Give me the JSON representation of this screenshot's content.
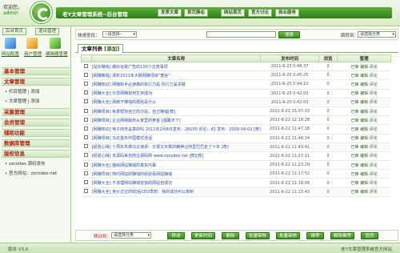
{
  "header": {
    "welcome": "欢迎您，",
    "user": "admin",
    "title": "老Y文章管理系统--后台管理",
    "links": [
      "发表文章",
      "首页静态",
      "网站首页",
      "官方讨论",
      "商业服务"
    ]
  },
  "sidebar": {
    "top_buttons": [
      "后台首页",
      "退出管理"
    ],
    "icon_links": [
      "网站配置",
      "用户管理",
      "编辑器管理"
    ],
    "sections": [
      {
        "title": "基本管理",
        "items": []
      },
      {
        "title": "文章管理",
        "items": [
          "栏目管理 | 添加",
          "文章管理 | 添加"
        ]
      },
      {
        "title": "采集管理",
        "items": []
      },
      {
        "title": "会员管理",
        "items": []
      },
      {
        "title": "辅助功能",
        "items": []
      },
      {
        "title": "数据库管理",
        "items": []
      },
      {
        "title": "版权信息",
        "items": [
          "zzcodes 源码发布",
          "官方网站：zzcodes.net"
        ]
      }
    ]
  },
  "filter": {
    "search_label": "快速查找：",
    "search_select": "--请选择--",
    "search_button": "搜索",
    "jump_label": "跳转到：",
    "jump_select": "请选择分类"
  },
  "list": {
    "tab_title": "文章列表",
    "tab_add": "[添加]",
    "columns": [
      "",
      "文章名称",
      "发布时间",
      "浏览",
      "管理"
    ],
    "rows": [
      {
        "title": "[站长赚钱] 做好谷歌广告的100个注意事项",
        "date": "2011-6-23 0:48:37",
        "views": "0",
        "ops": "已审 编辑 评论"
      },
      {
        "title": "[网赚教程] 诱析2011年大概网赚项目\"宽谷\"",
        "date": "2011-6-23 0:45:25",
        "views": "0",
        "ops": "已审 编辑 评论"
      },
      {
        "title": "[网赚知识] 网赚新手必读做的执行力是 执行力是关键",
        "date": "2011-6-23 0:44:10",
        "views": "0",
        "ops": "已审 编辑 评论"
      },
      {
        "title": "[网赚大全] 分享网赚如何生存成功",
        "date": "2011-6-23 0:42:03",
        "views": "0",
        "ops": "已审 编辑 评论"
      },
      {
        "title": "[网赚大全] 网络干赚钱的那些是什么",
        "date": "2011-6-23 0:42:03",
        "views": "0",
        "ops": "已审 编辑 评论"
      },
      {
        "title": "[网赚项目] 免费帮你自己的分站，自己赚钱[荐]",
        "date": "2011-6-22 15:07:33",
        "views": "0",
        "ops": "已审 编辑 评论"
      },
      {
        "title": "[网赚项目] 企业网络服务从家里的黄金 [福路天下]",
        "date": "2011-6-22 12:18:28",
        "views": "0",
        "ops": "已审 编辑 评论"
      },
      {
        "title": "[网赚知识] 电子商务是真的吗 2011年2月6日发布：28100 评论：43 发布：2009-04-03 [荐]",
        "date": "2011-6-22 11:47:18",
        "views": "0",
        "ops": "已审 编辑 评论"
      },
      {
        "title": "[网赚项目] 马云首年中国模式佳话",
        "date": "2011-6-22 11:46:24",
        "views": "0",
        "ops": "已审 编辑 评论"
      },
      {
        "title": "[经验心得] 十周年巩典马云演讲：又很又天真的精神让阿里巴巴走了十年 [荐]",
        "date": "2011-6-22 11:43:41",
        "views": "0",
        "ops": "已审 编辑 评论"
      },
      {
        "title": "[经验心得] 本源码来自商业源码网 www.zzcodes.net [荐][荐]",
        "date": "2011-6-22 11:27:11",
        "views": "0",
        "ops": "已审 编辑 评论"
      },
      {
        "title": "[网赚大全] 描绘网站赚钱的真实内幕",
        "date": "2011-6-22 11:23:20",
        "views": "0",
        "ops": "已审 编辑 评论"
      },
      {
        "title": "[网赚项目] 简约网站的赚钱的经验看网站赚钱",
        "date": "2011-6-22 11:17:52",
        "views": "0",
        "ops": "已审 编辑 评论"
      },
      {
        "title": "[网赚大全] 不该理网站赚钱容窗的网站自成功",
        "date": "2011-6-22 11:16:09",
        "views": "0",
        "ops": "已审 编辑 评论"
      },
      {
        "title": "[网赚大全] 身价过亿的80后CEO李想：我的成功可以复制",
        "date": "2011-6-22 11:15:43",
        "views": "0",
        "ops": "已审 编辑 评论"
      }
    ]
  },
  "bottom": {
    "move_label": "移动到：",
    "move_select": "请选择分类",
    "buttons": [
      "移动",
      "更新时间",
      "删除",
      "批量审核",
      "批量审核",
      "推荐",
      "解除推荐",
      "固顶"
    ]
  },
  "footer": {
    "version": "版本 V3.0",
    "copyright": "老Y文章管理系统官方网站"
  }
}
